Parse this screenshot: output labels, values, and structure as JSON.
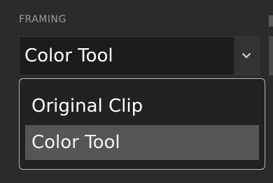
{
  "section": {
    "label": "FRAMING"
  },
  "framing_select": {
    "selected_value": "Color Tool",
    "toggle_icon": "chevron-down-icon",
    "options": [
      {
        "label": "Original Clip",
        "selected": false
      },
      {
        "label": "Color Tool",
        "selected": true
      }
    ]
  },
  "colors": {
    "background": "#2b2b2b",
    "field": "#1c1c1c",
    "highlight": "#555555",
    "list_border": "#b8b8b8"
  }
}
